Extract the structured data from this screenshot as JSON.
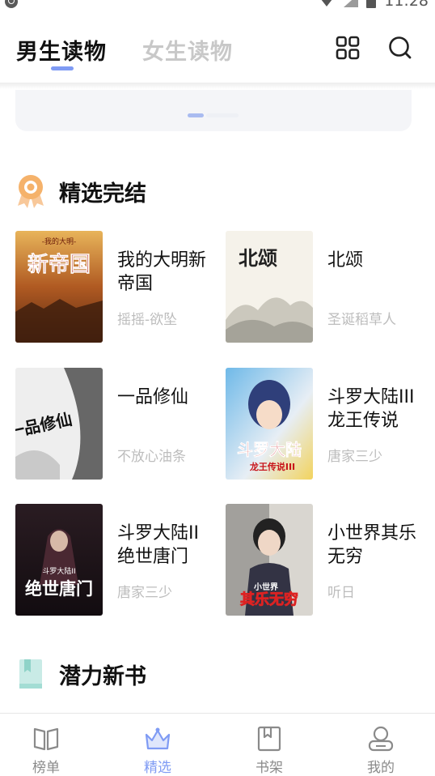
{
  "status_bar": {
    "time": "11:28"
  },
  "header": {
    "tabs": [
      {
        "label": "男生读物",
        "active": true
      },
      {
        "label": "女生读物",
        "active": false
      }
    ],
    "icons": [
      "grid-icon",
      "search-icon"
    ]
  },
  "banner": {
    "pages": 2,
    "active_index": 0
  },
  "sections": [
    {
      "title": "精选完结",
      "icon": "award-icon",
      "books": [
        {
          "title": "我的大明新帝国",
          "author": "摇摇-欲坠",
          "cover_text": "新帝国",
          "cover_sub": "-我的大明-"
        },
        {
          "title": "北颂",
          "author": "圣诞稻草人",
          "cover_text": "北颂"
        },
        {
          "title": "一品修仙",
          "author": "不放心油条",
          "cover_text": "一品修仙"
        },
        {
          "title": "斗罗大陆III龙王传说",
          "author": "唐家三少",
          "cover_text": "斗罗大陆",
          "cover_sub": "龙王传说III"
        },
        {
          "title": "斗罗大陆II绝世唐门",
          "author": "唐家三少",
          "cover_text": "绝世唐门",
          "cover_sub": "斗罗大陆II"
        },
        {
          "title": "小世界其乐无穷",
          "author": "听日",
          "cover_text": "其乐无穷",
          "cover_sub": "小世界"
        }
      ]
    },
    {
      "title": "潜力新书",
      "icon": "book-icon"
    }
  ],
  "bottom_nav": [
    {
      "label": "榜单",
      "icon": "open-book-icon",
      "active": false
    },
    {
      "label": "精选",
      "icon": "crown-icon",
      "active": true
    },
    {
      "label": "书架",
      "icon": "bookshelf-icon",
      "active": false
    },
    {
      "label": "我的",
      "icon": "profile-icon",
      "active": false
    }
  ],
  "colors": {
    "accent": "#7f9bf4",
    "inactive_tab": "#c8c8c8",
    "author": "#bdbdbd",
    "award": "#f5b26b"
  }
}
